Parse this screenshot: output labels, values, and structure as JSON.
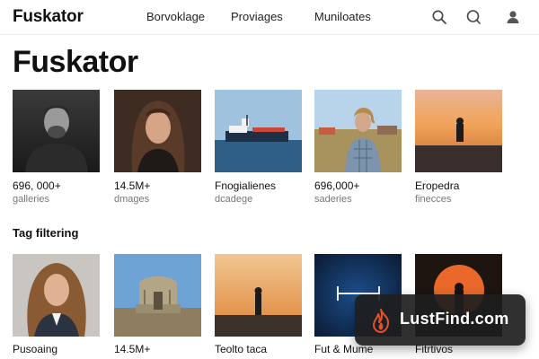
{
  "header": {
    "logo": "Fuskator",
    "nav": [
      "Borvoklage",
      "Proviages",
      "Muniloates"
    ]
  },
  "page_title": "Fuskator",
  "grid_row1": [
    {
      "line1": "696, 000+",
      "line2": "galleries"
    },
    {
      "line1": "14.5M+",
      "line2": "dmages"
    },
    {
      "line1": "Fnogialienes",
      "line2": "dcadege"
    },
    {
      "line1": "696,000+",
      "line2": "saderies"
    },
    {
      "line1": "Eropedra",
      "line2": "finecces"
    }
  ],
  "section_title": "Tag filtering",
  "grid_row2": [
    {
      "line1": "Pusoaing"
    },
    {
      "line1": "14.5M+"
    },
    {
      "line1": "Teolto taca"
    },
    {
      "line1": "Fut & Mume"
    },
    {
      "line1": "Fitrtivos"
    }
  ],
  "watermark": {
    "text": "LustFind.com"
  },
  "colors": {
    "badge_bg": "#1e1e1e",
    "flame": "#e0522a",
    "text": "#111111",
    "muted": "#777777"
  },
  "icons": [
    "search-icon",
    "chat-icon",
    "user-icon",
    "flame-icon"
  ]
}
